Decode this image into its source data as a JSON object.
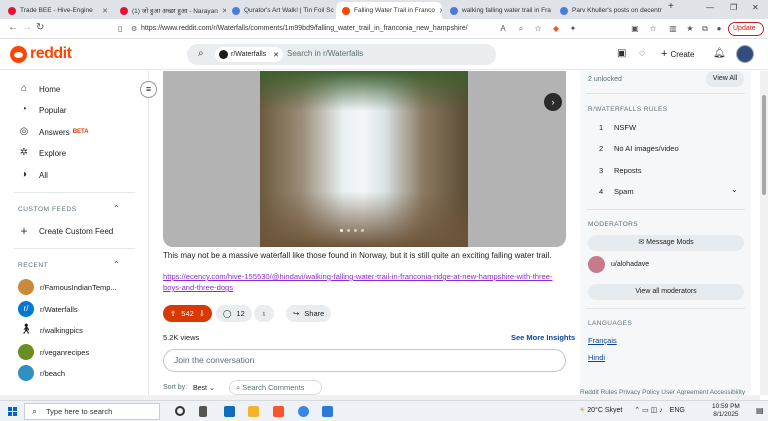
{
  "browser": {
    "tabs": [
      {
        "label": "Trade BEE - Hive-Engine",
        "color": "#e31337"
      },
      {
        "label": "(1) जो हुआ अच्छा हुआ - Narayan",
        "color": "#e31337"
      },
      {
        "label": "Qurator's Art Walk! | Tin Foil Sc",
        "color": "#4a7ae0"
      },
      {
        "label": "Falling Water Trail in Franco",
        "color": "#ff4500",
        "active": true
      },
      {
        "label": "walking falling water trail in Fra",
        "color": "#4a7ae0"
      },
      {
        "label": "Parv Khuller's posts on decentr",
        "color": "#4a7ae0"
      }
    ],
    "new_tab": "+",
    "url": "https://www.reddit.com/r/Waterfalls/comments/1m99bd9/falling_water_trail_in_franconia_new_hampshire/",
    "update_label": "Update",
    "accent": "#c5221f"
  },
  "header": {
    "logo_text": "reddit",
    "search_chip": "r/Waterfalls",
    "search_placeholder": "Search in r/Waterfalls",
    "create_label": "Create",
    "brand_color": "#ff4500"
  },
  "sidebar": {
    "nav": [
      {
        "label": "Home",
        "icon": "home-icon",
        "glyph": "⌂"
      },
      {
        "label": "Popular",
        "icon": "popular-icon",
        "glyph": "◔"
      },
      {
        "label": "Answers",
        "icon": "answers-icon",
        "glyph": "◎",
        "badge": "BETA"
      },
      {
        "label": "Explore",
        "icon": "explore-icon",
        "glyph": "✲"
      },
      {
        "label": "All",
        "icon": "all-icon",
        "glyph": "◑"
      }
    ],
    "custom_feeds_heading": "CUSTOM FEEDS",
    "create_custom_feed": "Create Custom Feed",
    "recent_heading": "RECENT",
    "recent": [
      {
        "label": "r/FamousIndianTemp...",
        "color": "#c98b3a"
      },
      {
        "label": "r/Waterfalls",
        "color": "#0079d3"
      },
      {
        "label": "r/walkingpics",
        "color": "#ffffff"
      },
      {
        "label": "r/veganrecipes",
        "color": "#6b8e23"
      },
      {
        "label": "r/beach",
        "color": "#2f8fbf"
      }
    ]
  },
  "post": {
    "body": "This may not be a massive waterfall like those found in Norway, but it is still quite an exciting falling water trail.",
    "link": "https://ecency.com/hive-155530/@hindavi/walking-falling-water-trail-in-franconia-ridge-at-new-hampshire-with-three-boys-and-three-dogs",
    "votes": "542",
    "comments": "12",
    "share_label": "Share",
    "views": "5.2K views",
    "insights": "See More Insights",
    "comment_placeholder": "Join the conversation",
    "sort_label": "Sort by:",
    "sort_value": "Best",
    "search_comments": "Search Comments"
  },
  "right_panel": {
    "unlocked": "2 unlocked",
    "view_all": "View All",
    "rules_heading": "R/WATERFALLS RULES",
    "rules": [
      {
        "num": "1",
        "text": "NSFW"
      },
      {
        "num": "2",
        "text": "No AI images/video"
      },
      {
        "num": "3",
        "text": "Reposts"
      },
      {
        "num": "4",
        "text": "Spam"
      }
    ],
    "moderators_heading": "MODERATORS",
    "message_mods": "Message Mods",
    "moderator": "u/alohadave",
    "view_all_moderators": "View all moderators",
    "languages_heading": "LANGUAGES",
    "languages": [
      "Français",
      "Hindi"
    ],
    "footer": "Reddit Rules   Privacy Policy   User Agreement   Accessibility"
  },
  "taskbar": {
    "search_placeholder": "Type here to search",
    "weather": "20°C  Skyet",
    "lang": "ENG",
    "time": "10:59 PM",
    "date": "8/1/2025"
  }
}
